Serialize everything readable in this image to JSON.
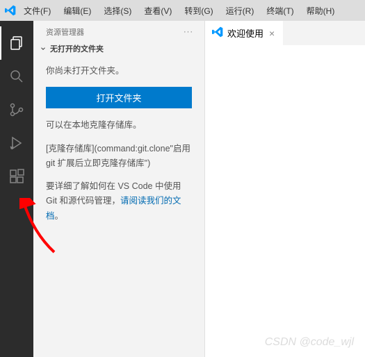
{
  "menu": {
    "items": [
      "文件(F)",
      "编辑(E)",
      "选择(S)",
      "查看(V)",
      "转到(G)",
      "运行(R)",
      "终端(T)",
      "帮助(H)"
    ]
  },
  "activity": {
    "items": [
      "explorer",
      "search",
      "source-control",
      "run-debug",
      "extensions"
    ]
  },
  "sidebar": {
    "title": "资源管理器",
    "section": "无打开的文件夹",
    "msg1": "你尚未打开文件夹。",
    "btn": "打开文件夹",
    "msg2": "可以在本地克隆存储库。",
    "msg3": "[克隆存储库](command:git.clone\"启用 git 扩展后立即克隆存储库\")",
    "msg4a": "要详细了解如何在 VS Code 中使用 Git 和源代码管理，",
    "msg4b": "请阅读我们的文档",
    "msg4c": "。"
  },
  "editor": {
    "tab_label": "欢迎使用"
  },
  "watermark": "CSDN @code_wjl"
}
